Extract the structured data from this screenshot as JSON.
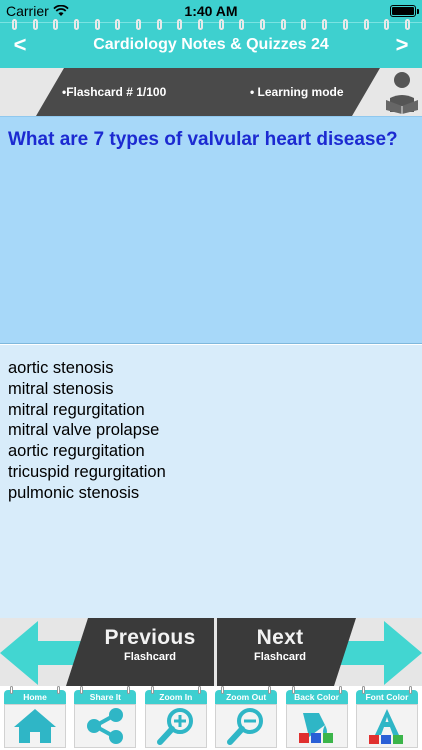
{
  "status_bar": {
    "carrier": "Carrier",
    "time": "1:40 AM"
  },
  "nav": {
    "title": "Cardiology Notes & Quizzes 24",
    "back_glyph": "<",
    "forward_glyph": ">"
  },
  "info": {
    "flashcard_label": "•Flashcard #  1/100",
    "mode_label": "• Learning mode"
  },
  "question": "What are 7 types of valvular heart disease?",
  "answers": [
    "aortic stenosis",
    "mitral stenosis",
    "mitral regurgitation",
    "mitral valve prolapse",
    "aortic regurgitation",
    "tricuspid regurgitation",
    "pulmonic stenosis"
  ],
  "buttons": {
    "previous": {
      "title": "Previous",
      "subtitle": "Flashcard"
    },
    "next": {
      "title": "Next",
      "subtitle": "Flashcard"
    }
  },
  "toolbar": [
    {
      "label": "Home",
      "icon": "home-icon"
    },
    {
      "label": "Share It",
      "icon": "share-icon"
    },
    {
      "label": "Zoom In",
      "icon": "zoom-in-icon"
    },
    {
      "label": "Zoom Out",
      "icon": "zoom-out-icon"
    },
    {
      "label": "Back Color",
      "icon": "back-color-icon"
    },
    {
      "label": "Font Color",
      "icon": "font-color-icon"
    }
  ],
  "colors": {
    "teal": "#3ed0cf",
    "question_bg": "#a7d8f9",
    "answer_bg": "#d8ecfa",
    "question_text": "#1c2ad1",
    "dark_band": "#3a3a3a"
  }
}
